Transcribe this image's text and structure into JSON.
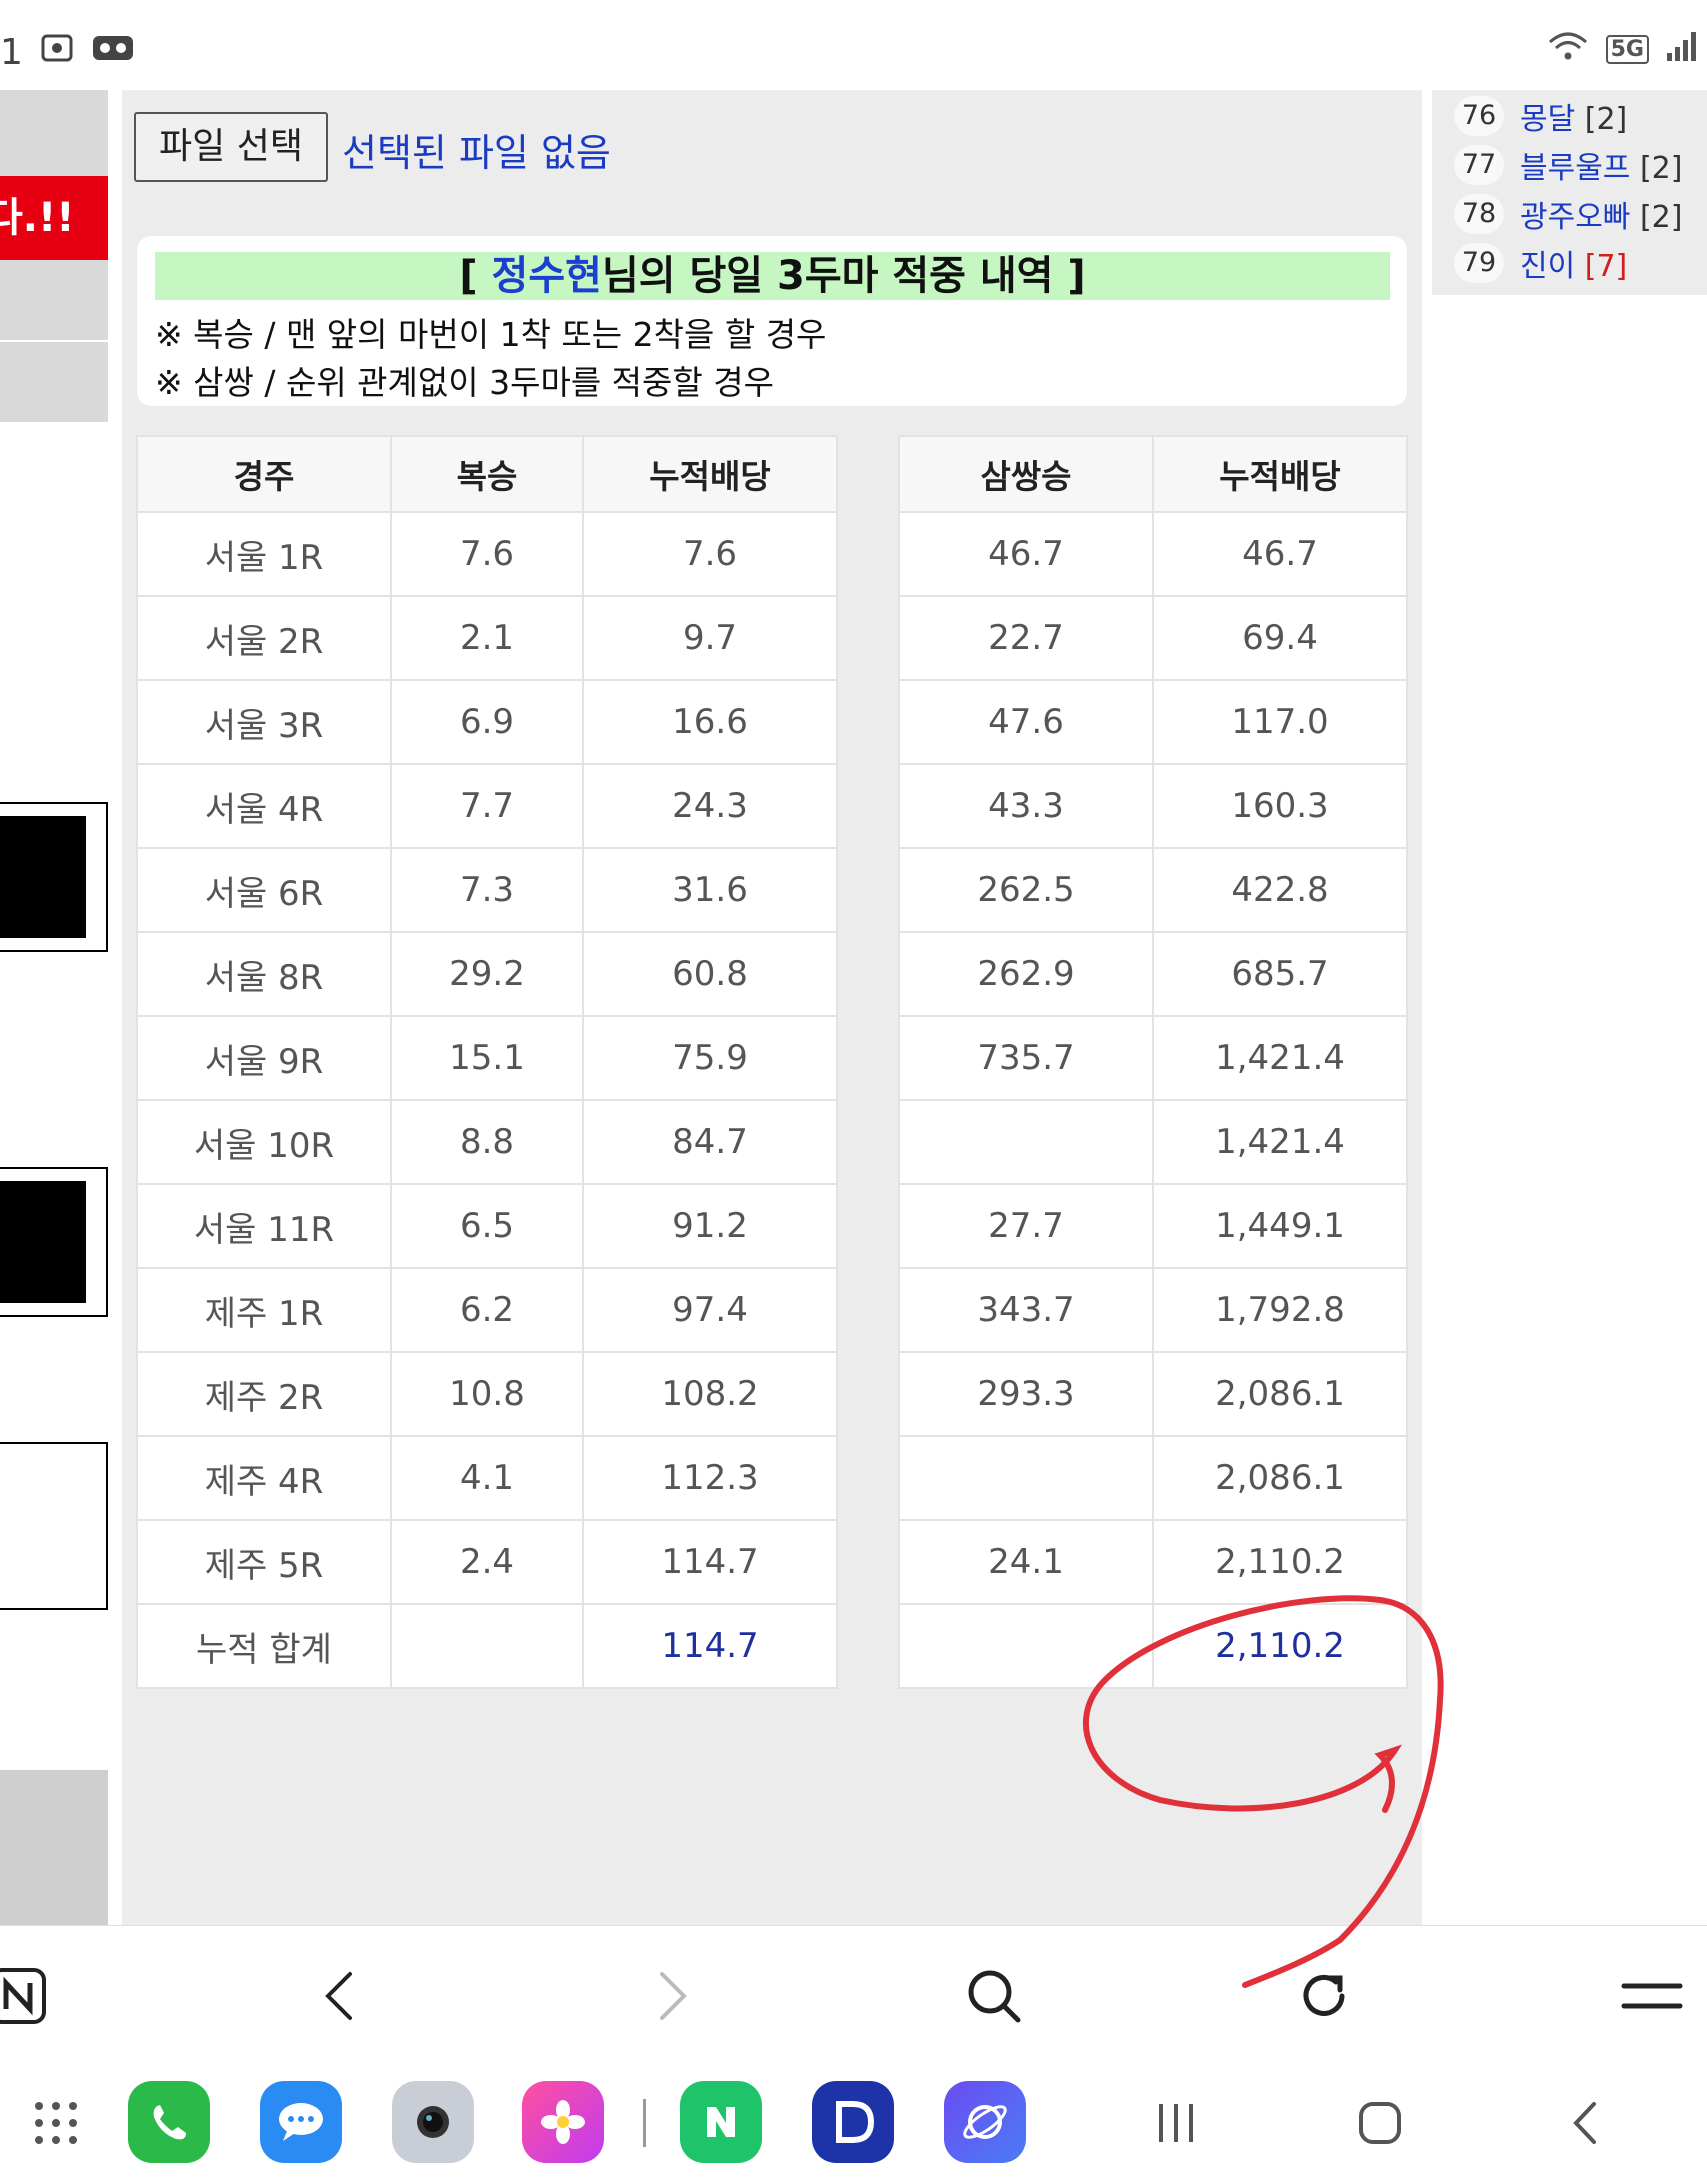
{
  "status_bar": {
    "left_text": "1",
    "network": "5G"
  },
  "left_banner": {
    "text": "다.!!"
  },
  "file_input": {
    "button_label": "파일 선택",
    "status": "선택된 파일 없음"
  },
  "notice": {
    "title_open": "[ ",
    "title_name": "정수현",
    "title_rest": "님의 당일 3두마 적중 내역 ]",
    "lines": [
      "※ 복승 / 맨 앞의 마번이 1착 또는 2착을 할 경우",
      "※ 삼쌍 / 순위 관계없이 3두마를 적중할 경우"
    ]
  },
  "table_left": {
    "headers": [
      "경주",
      "복승",
      "누적배당"
    ],
    "rows": [
      [
        "서울 1R",
        "7.6",
        "7.6"
      ],
      [
        "서울 2R",
        "2.1",
        "9.7"
      ],
      [
        "서울 3R",
        "6.9",
        "16.6"
      ],
      [
        "서울 4R",
        "7.7",
        "24.3"
      ],
      [
        "서울 6R",
        "7.3",
        "31.6"
      ],
      [
        "서울 8R",
        "29.2",
        "60.8"
      ],
      [
        "서울 9R",
        "15.1",
        "75.9"
      ],
      [
        "서울 10R",
        "8.8",
        "84.7"
      ],
      [
        "서울 11R",
        "6.5",
        "91.2"
      ],
      [
        "제주 1R",
        "6.2",
        "97.4"
      ],
      [
        "제주 2R",
        "10.8",
        "108.2"
      ],
      [
        "제주 4R",
        "4.1",
        "112.3"
      ],
      [
        "제주 5R",
        "2.4",
        "114.7"
      ]
    ],
    "total_label": "누적 합계",
    "total_value": "114.7"
  },
  "table_right": {
    "headers": [
      "삼쌍승",
      "누적배당"
    ],
    "rows": [
      [
        "46.7",
        "46.7"
      ],
      [
        "22.7",
        "69.4"
      ],
      [
        "47.6",
        "117.0"
      ],
      [
        "43.3",
        "160.3"
      ],
      [
        "262.5",
        "422.8"
      ],
      [
        "262.9",
        "685.7"
      ],
      [
        "735.7",
        "1,421.4"
      ],
      [
        "",
        "1,421.4"
      ],
      [
        "27.7",
        "1,449.1"
      ],
      [
        "343.7",
        "1,792.8"
      ],
      [
        "293.3",
        "2,086.1"
      ],
      [
        "",
        "2,086.1"
      ],
      [
        "24.1",
        "2,110.2"
      ]
    ],
    "total_value": "2,110.2"
  },
  "ranking": [
    {
      "num": "76",
      "name": "몽달",
      "count": "[2]"
    },
    {
      "num": "77",
      "name": "블루울프",
      "count": "[2]"
    },
    {
      "num": "78",
      "name": "광주오빠",
      "count": "[2]"
    },
    {
      "num": "79",
      "name": "진이",
      "count": "[7]",
      "hot": true
    }
  ],
  "colors": {
    "accent_blue": "#1a3bc2",
    "highlight_green": "#c6f7c3",
    "annotation_red": "#e0303a",
    "banner_red": "#e60012"
  },
  "toolbar": {
    "icons": [
      "naver-n-icon",
      "back-icon",
      "forward-icon",
      "search-icon",
      "reload-icon",
      "menu-icon"
    ]
  },
  "dock": {
    "apps": [
      "phone-icon",
      "messages-icon",
      "camera-icon",
      "gallery-icon",
      "naver-icon",
      "d-app-icon",
      "internet-icon"
    ]
  }
}
